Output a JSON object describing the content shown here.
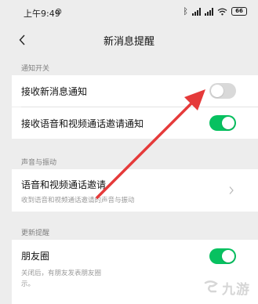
{
  "status_bar": {
    "time": "上午9:49",
    "dnd": "⊘",
    "battery": "66"
  },
  "nav": {
    "title": "新消息提醒"
  },
  "sections": {
    "notify_switch": {
      "header": "通知开关"
    },
    "sound_vibration": {
      "header": "声音与振动"
    },
    "updates": {
      "header": "更新提醒"
    }
  },
  "rows": {
    "receive_new": {
      "label": "接收新消息通知",
      "toggle_on": false
    },
    "receive_call": {
      "label": "接收语音和视频通话邀请通知",
      "toggle_on": true
    },
    "call_settings": {
      "label": "语音和视频通话邀请",
      "sub": "收到语音和视频通话邀请的声音与振动"
    },
    "moments": {
      "label": "朋友圈",
      "sub_line1": "关闭后，有朋友发表朋友圈",
      "sub_line2": "示。",
      "toggle_on": true
    }
  },
  "colors": {
    "toggle_on": "#07c160",
    "toggle_off": "#d9d9d9",
    "arrow": "#e53a3a"
  },
  "watermark": {
    "text": "九游"
  }
}
